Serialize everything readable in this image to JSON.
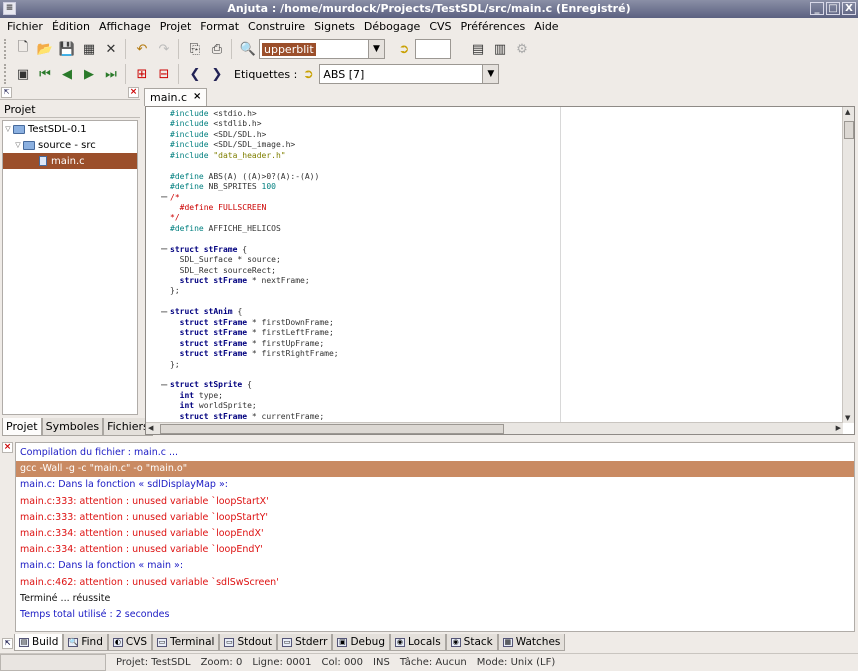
{
  "window": {
    "title": "Anjuta : /home/murdock/Projects/TestSDL/src/main.c (Enregistré)",
    "buttons": [
      "_",
      "□",
      "X"
    ]
  },
  "menu": [
    "Fichier",
    "Édition",
    "Affichage",
    "Projet",
    "Format",
    "Construire",
    "Signets",
    "Débogage",
    "CVS",
    "Préférences",
    "Aide"
  ],
  "toolbar": {
    "search_value": "upperblit",
    "goto_value": "",
    "labels_text": "Etiquettes :",
    "labels_combo": "ABS [7]",
    "icons1": [
      "new-file-icon",
      "open-folder-icon",
      "save-icon",
      "save-all-icon",
      "close-file-icon",
      "undo-icon",
      "redo-icon",
      "import-icon",
      "print-icon",
      "find-icon"
    ],
    "icons2": [
      "project-icon",
      "first-icon",
      "prev-icon",
      "next-icon",
      "last-icon",
      "bookmark-add-icon",
      "bookmark-remove-icon",
      "prev-bookmark-icon",
      "next-bookmark-icon"
    ]
  },
  "project_panel": {
    "header": "Projet",
    "tree": [
      {
        "label": "TestSDL-0.1",
        "level": 0,
        "icon": "folder-icon"
      },
      {
        "label": "source - src",
        "level": 1,
        "icon": "folder-icon"
      },
      {
        "label": "main.c",
        "level": 2,
        "icon": "file-icon",
        "selected": true
      }
    ],
    "tabs": [
      "Projet",
      "Symboles",
      "Fichiers"
    ]
  },
  "editor": {
    "tab": "main.c",
    "lines": [
      [
        [
          "#include ",
          "pp"
        ],
        [
          "<stdio.h>",
          "hdr"
        ]
      ],
      [
        [
          "#include ",
          "pp"
        ],
        [
          "<stdlib.h>",
          "hdr"
        ]
      ],
      [
        [
          "#include ",
          "pp"
        ],
        [
          "<SDL/SDL.h>",
          "hdr"
        ]
      ],
      [
        [
          "#include ",
          "pp"
        ],
        [
          "<SDL/SDL_image.h>",
          "hdr"
        ]
      ],
      [
        [
          "#include ",
          "pp"
        ],
        [
          "\"data_header.h\"",
          "str"
        ]
      ],
      [],
      [
        [
          "#define ",
          "pp"
        ],
        [
          "ABS(A) ((A)>0?(A):-(A))",
          "hdr"
        ]
      ],
      [
        [
          "#define ",
          "pp"
        ],
        [
          "NB_SPRITES ",
          "hdr"
        ],
        [
          "100",
          "pp"
        ]
      ],
      [
        [
          "/*",
          "cm"
        ]
      ],
      [
        [
          "  #define FULLSCREEN",
          "cm"
        ]
      ],
      [
        [
          "*/",
          "cm"
        ]
      ],
      [
        [
          "#define ",
          "pp"
        ],
        [
          "AFFICHE_HELICOS",
          "hdr"
        ]
      ],
      [],
      [
        [
          "struct ",
          "kw"
        ],
        [
          "stFrame",
          "kw"
        ],
        [
          " {",
          "hdr"
        ]
      ],
      [
        [
          "  SDL_Surface * source;",
          "hdr"
        ]
      ],
      [
        [
          "  SDL_Rect sourceRect;",
          "hdr"
        ]
      ],
      [
        [
          "  ",
          "hdr"
        ],
        [
          "struct ",
          "kw"
        ],
        [
          "stFrame",
          "kw"
        ],
        [
          " * nextFrame;",
          "hdr"
        ]
      ],
      [
        [
          "};",
          "hdr"
        ]
      ],
      [],
      [
        [
          "struct ",
          "kw"
        ],
        [
          "stAnim",
          "kw"
        ],
        [
          " {",
          "hdr"
        ]
      ],
      [
        [
          "  ",
          "hdr"
        ],
        [
          "struct ",
          "kw"
        ],
        [
          "stFrame",
          "kw"
        ],
        [
          " * firstDownFrame;",
          "hdr"
        ]
      ],
      [
        [
          "  ",
          "hdr"
        ],
        [
          "struct ",
          "kw"
        ],
        [
          "stFrame",
          "kw"
        ],
        [
          " * firstLeftFrame;",
          "hdr"
        ]
      ],
      [
        [
          "  ",
          "hdr"
        ],
        [
          "struct ",
          "kw"
        ],
        [
          "stFrame",
          "kw"
        ],
        [
          " * firstUpFrame;",
          "hdr"
        ]
      ],
      [
        [
          "  ",
          "hdr"
        ],
        [
          "struct ",
          "kw"
        ],
        [
          "stFrame",
          "kw"
        ],
        [
          " * firstRightFrame;",
          "hdr"
        ]
      ],
      [
        [
          "};",
          "hdr"
        ]
      ],
      [],
      [
        [
          "struct ",
          "kw"
        ],
        [
          "stSprite",
          "kw"
        ],
        [
          " {",
          "hdr"
        ]
      ],
      [
        [
          "  ",
          "hdr"
        ],
        [
          "int ",
          "kw"
        ],
        [
          "type;",
          "hdr"
        ]
      ],
      [
        [
          "  ",
          "hdr"
        ],
        [
          "int ",
          "kw"
        ],
        [
          "worldSprite;",
          "hdr"
        ]
      ],
      [
        [
          "  ",
          "hdr"
        ],
        [
          "struct ",
          "kw"
        ],
        [
          "stFrame",
          "kw"
        ],
        [
          " * currentFrame;",
          "hdr"
        ]
      ]
    ],
    "fold_markers": [
      8,
      13,
      19,
      26
    ]
  },
  "messages": [
    {
      "text": "Compilation du fichier : main.c ...",
      "color": "blue"
    },
    {
      "text": "gcc    -Wall   -g  -c \"main.c\" -o \"main.o\"",
      "color": "hl"
    },
    {
      "text": "main.c: Dans la fonction « sdlDisplayMap »:",
      "color": "blue"
    },
    {
      "text": "main.c:333: attention : unused variable `loopStartX'",
      "color": "red"
    },
    {
      "text": "main.c:333: attention : unused variable `loopStartY'",
      "color": "red"
    },
    {
      "text": "main.c:334: attention : unused variable `loopEndX'",
      "color": "red"
    },
    {
      "text": "main.c:334: attention : unused variable `loopEndY'",
      "color": "red"
    },
    {
      "text": "main.c: Dans la fonction « main »:",
      "color": "blue"
    },
    {
      "text": "main.c:462: attention : unused variable `sdlSwScreen'",
      "color": "red"
    },
    {
      "text": "Terminé ... réussite",
      "color": "black"
    },
    {
      "text": "Temps total utilisé : 2 secondes",
      "color": "blue"
    }
  ],
  "bottom_tabs": [
    "Build",
    "Find",
    "CVS",
    "Terminal",
    "Stdout",
    "Stderr",
    "Debug",
    "Locals",
    "Stack",
    "Watches"
  ],
  "status": {
    "project": "Projet: TestSDL",
    "zoom": "Zoom: 0",
    "line": "Ligne: 0001",
    "col": "Col: 000",
    "mode_ins": "INS",
    "task": "Tâche: Aucun",
    "mode": "Mode: Unix (LF)"
  }
}
